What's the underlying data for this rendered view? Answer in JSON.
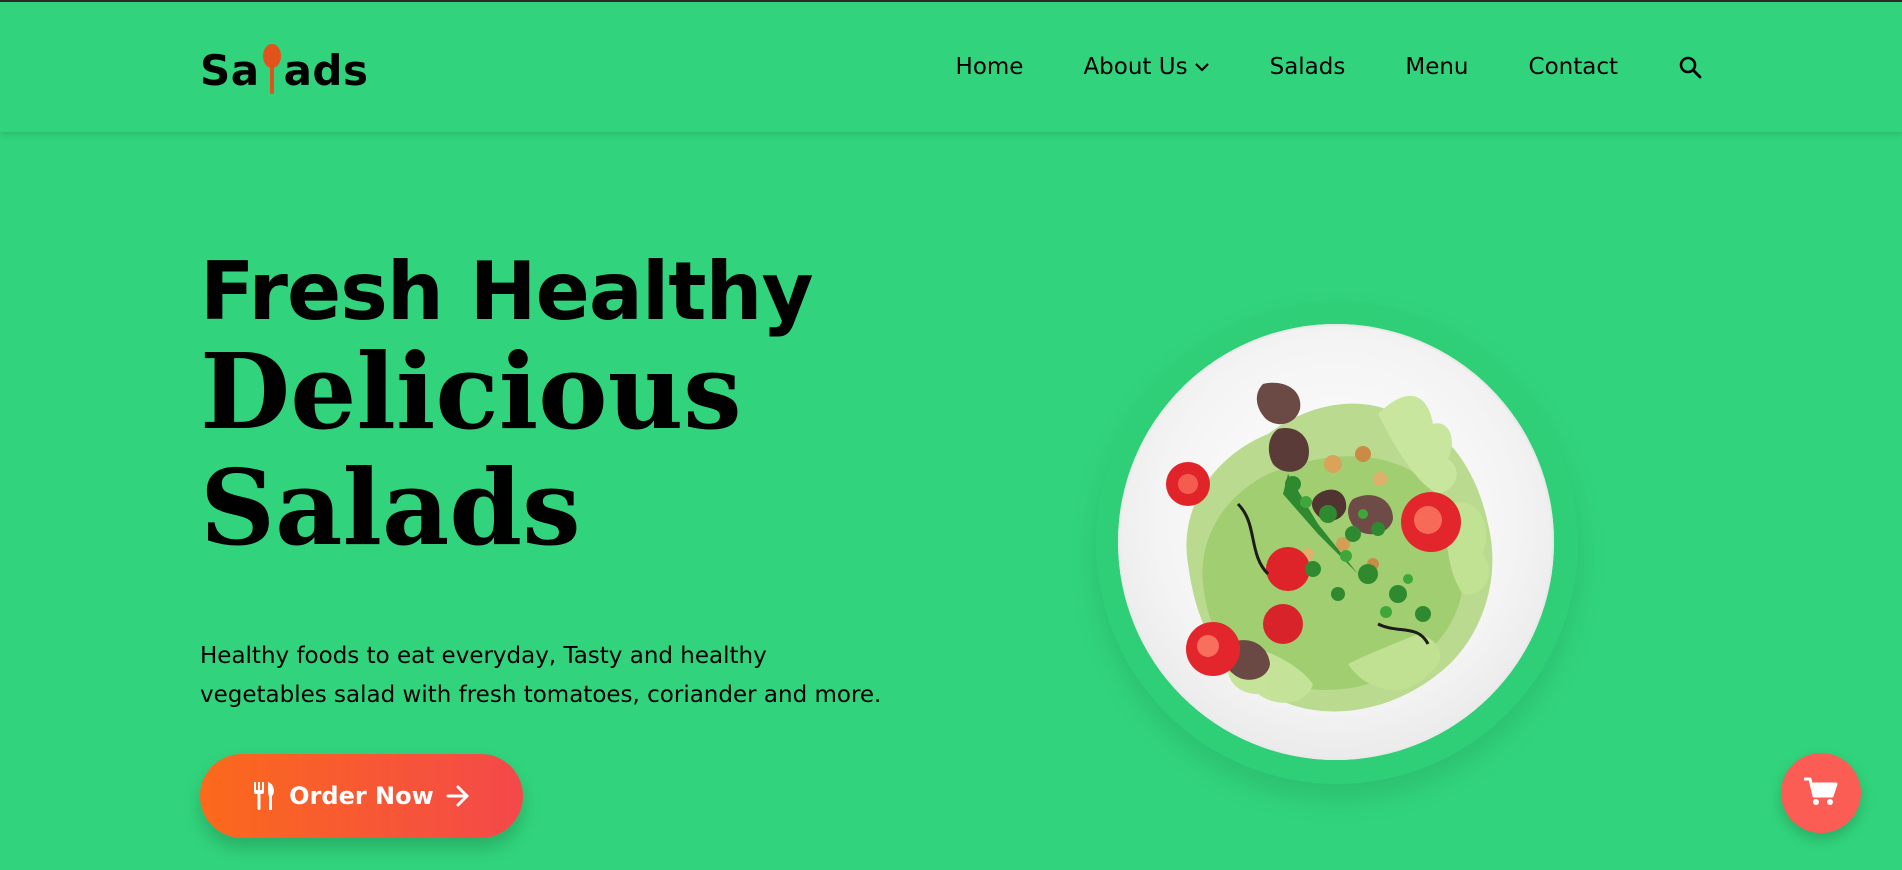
{
  "colors": {
    "background": "#31d47c",
    "accent_gradient_start": "#fb6a1b",
    "accent_gradient_end": "#f4484a",
    "cart_button": "#fb5d55",
    "spoon": "#e2521b",
    "text": "#000000"
  },
  "logo": {
    "text_before": "Sa",
    "text_after": "ads",
    "icon": "spoon-icon"
  },
  "nav": {
    "items": [
      {
        "label": "Home"
      },
      {
        "label": "About Us",
        "icon": "chevron-down-icon"
      },
      {
        "label": "Salads"
      },
      {
        "label": "Menu"
      },
      {
        "label": "Contact"
      }
    ],
    "search_icon": "search-icon"
  },
  "hero": {
    "title_line1": "Fresh Healthy",
    "title_line2": "Delicious",
    "title_line3": "Salads",
    "description": "Healthy foods to eat everyday, Tasty and healthy vegetables salad with fresh tomatoes, coriander and more.",
    "button": {
      "label": "Order Now",
      "left_icon": "utensils-icon",
      "right_icon": "arrow-right-icon"
    },
    "image": "salad-plate-image"
  },
  "cart": {
    "icon": "shopping-cart-icon"
  }
}
